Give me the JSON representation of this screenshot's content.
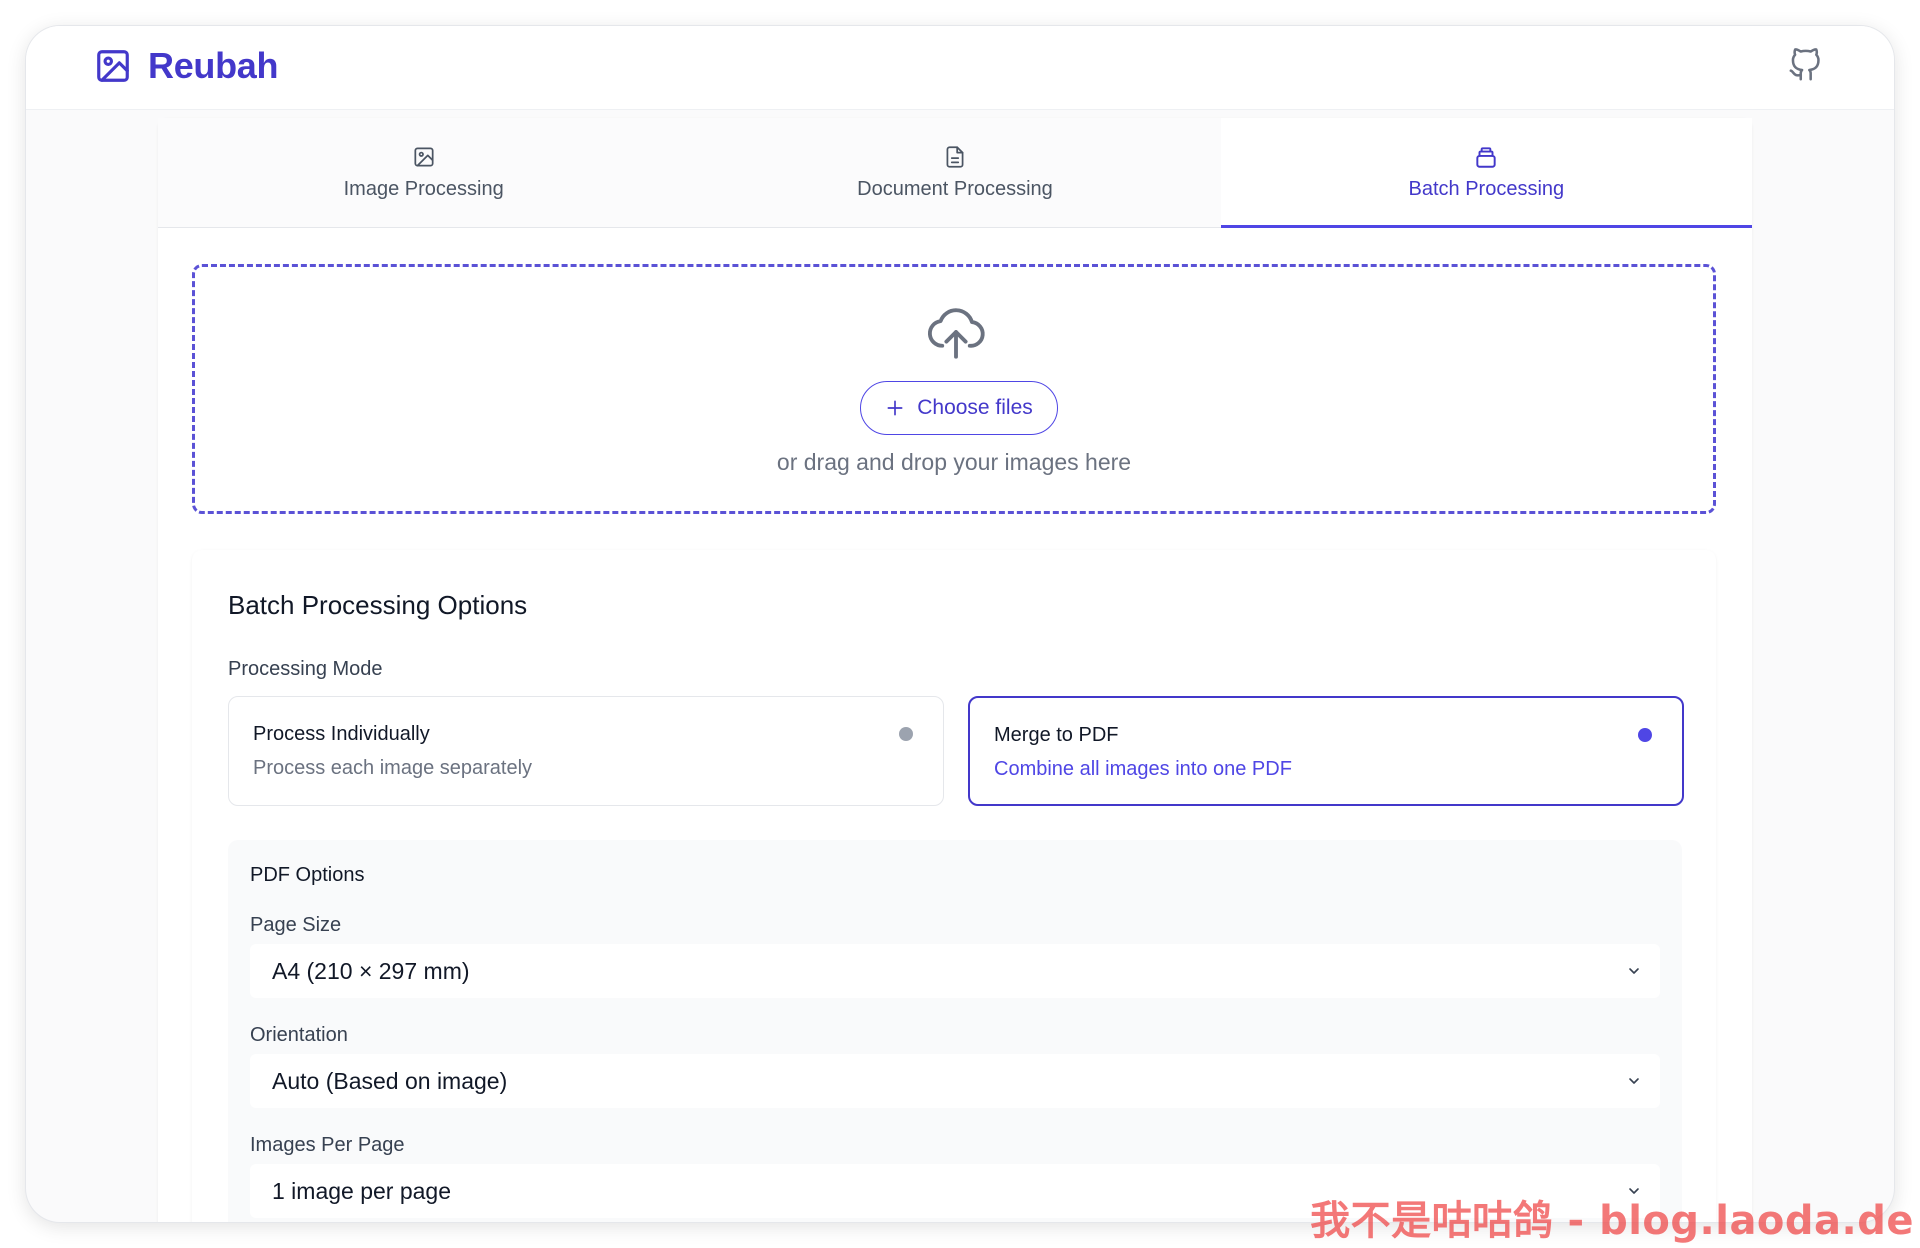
{
  "app": {
    "name": "Reubah"
  },
  "header": {
    "brand_icon": "image-icon",
    "github_icon": "github-icon"
  },
  "tabs": [
    {
      "label": "Image Processing",
      "icon": "image-icon",
      "active": false
    },
    {
      "label": "Document Processing",
      "icon": "document-icon",
      "active": false
    },
    {
      "label": "Batch Processing",
      "icon": "stack-icon",
      "active": true
    }
  ],
  "upload": {
    "icon": "cloud-upload-icon",
    "button_label": "Choose files",
    "hint": "or drag and drop your images here"
  },
  "batch_options": {
    "title": "Batch Processing Options",
    "mode_label": "Processing Mode",
    "modes": [
      {
        "name": "Process Individually",
        "description": "Process each image separately",
        "selected": false
      },
      {
        "name": "Merge to PDF",
        "description": "Combine all images into one PDF",
        "selected": true
      }
    ],
    "pdf": {
      "title": "PDF Options",
      "page_size": {
        "label": "Page Size",
        "value": "A4 (210 × 297 mm)"
      },
      "orientation": {
        "label": "Orientation",
        "value": "Auto (Based on image)"
      },
      "images_per_page": {
        "label": "Images Per Page",
        "value": "1 image per page"
      }
    }
  },
  "watermark": "我不是咕咕鸽 - blog.laoda.de",
  "colors": {
    "accent": "#4f46e5",
    "brand": "#4338ca",
    "muted": "#6b7280"
  }
}
